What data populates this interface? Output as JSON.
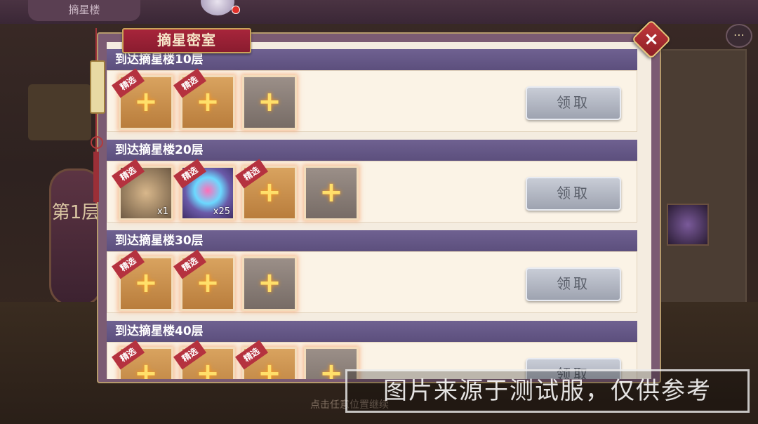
{
  "background": {
    "top_tab": "摘星楼",
    "pillar_text": "第1层",
    "hint": "点击任意位置继续"
  },
  "dialog": {
    "title": "摘星密室",
    "close_label": "×",
    "rows": [
      {
        "title": "到达摘星楼10层",
        "claim_label": "领取",
        "slots": [
          {
            "type": "empty",
            "badge": "精选"
          },
          {
            "type": "empty",
            "badge": "精选"
          },
          {
            "type": "empty-grey",
            "badge": ""
          }
        ]
      },
      {
        "title": "到达摘星楼20层",
        "claim_label": "领取",
        "slots": [
          {
            "type": "item",
            "badge": "精选",
            "count": "x1"
          },
          {
            "type": "item",
            "badge": "精选",
            "count": "x25"
          },
          {
            "type": "empty",
            "badge": "精选"
          },
          {
            "type": "empty-grey",
            "badge": ""
          }
        ]
      },
      {
        "title": "到达摘星楼30层",
        "claim_label": "领取",
        "slots": [
          {
            "type": "empty",
            "badge": "精选"
          },
          {
            "type": "empty",
            "badge": "精选"
          },
          {
            "type": "empty-grey",
            "badge": ""
          }
        ]
      },
      {
        "title": "到达摘星楼40层",
        "claim_label": "领取",
        "slots": [
          {
            "type": "empty",
            "badge": "精选"
          },
          {
            "type": "empty",
            "badge": "精选"
          },
          {
            "type": "empty",
            "badge": "精选"
          },
          {
            "type": "empty-grey",
            "badge": ""
          }
        ]
      }
    ]
  },
  "watermark": "图片来源于测试服，仅供参考",
  "plus_symbol": "+",
  "chat_icon": "chat-bubble-icon"
}
